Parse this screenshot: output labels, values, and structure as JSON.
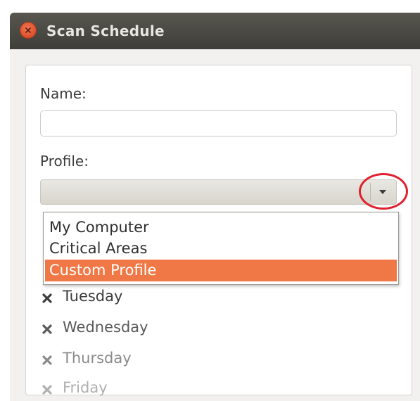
{
  "window": {
    "title": "Scan Schedule"
  },
  "form": {
    "name_label": "Name:",
    "name_value": "",
    "profile_label": "Profile:",
    "profile_value": ""
  },
  "dropdown": {
    "options": [
      "My Computer",
      "Critical Areas",
      "Custom Profile"
    ],
    "highlighted": "Custom Profile"
  },
  "days": [
    {
      "label": "Tuesday",
      "checked": true
    },
    {
      "label": "Wednesday",
      "checked": true
    },
    {
      "label": "Thursday",
      "checked": true
    },
    {
      "label": "Friday",
      "checked": true
    }
  ],
  "colors": {
    "highlight": "#f07846",
    "annotation": "#e0222e",
    "close_button": "#dc4f2a"
  },
  "icons": {
    "close": "close-icon",
    "dropdown_arrow": "chevron-down-icon",
    "checkbox": "check-x-icon"
  }
}
